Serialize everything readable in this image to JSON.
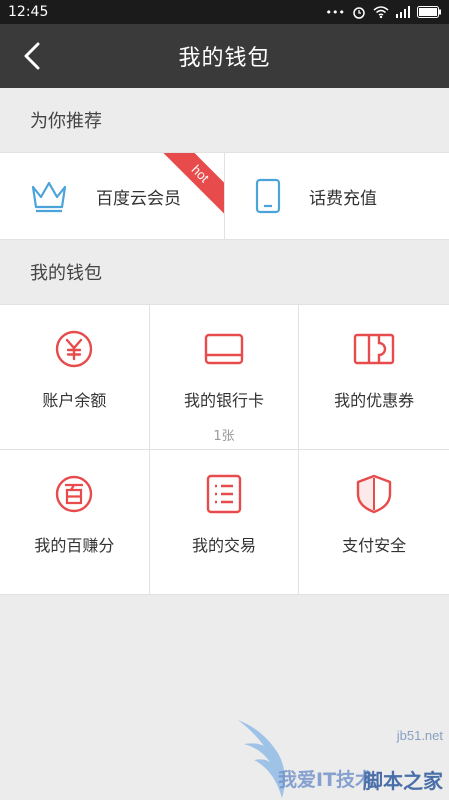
{
  "status_bar": {
    "time": "12:45",
    "battery": ""
  },
  "title_bar": {
    "title": "我的钱包"
  },
  "recommend": {
    "section_title": "为你推荐",
    "items": [
      {
        "label": "百度云会员",
        "icon": "crown-icon",
        "badge": "hot"
      },
      {
        "label": "话费充值",
        "icon": "phone-icon"
      }
    ]
  },
  "wallet": {
    "section_title": "我的钱包",
    "items": [
      {
        "label": "账户余额",
        "icon": "yen-icon",
        "sub": ""
      },
      {
        "label": "我的银行卡",
        "icon": "bank-card-icon",
        "sub": "1张"
      },
      {
        "label": "我的优惠券",
        "icon": "coupon-icon",
        "sub": ""
      },
      {
        "label": "我的百赚分",
        "icon": "bai-points-icon",
        "sub": ""
      },
      {
        "label": "我的交易",
        "icon": "transactions-list-icon",
        "sub": ""
      },
      {
        "label": "支付安全",
        "icon": "shield-icon",
        "sub": ""
      }
    ]
  },
  "watermark": {
    "site": "jb51.net",
    "name": "脚本之家",
    "left_text": "我爱IT技术"
  },
  "colors": {
    "accent": "#e84b4b",
    "recommend_icon": "#4ba3dc",
    "header": "#3a3a3a",
    "background": "#ececec"
  }
}
